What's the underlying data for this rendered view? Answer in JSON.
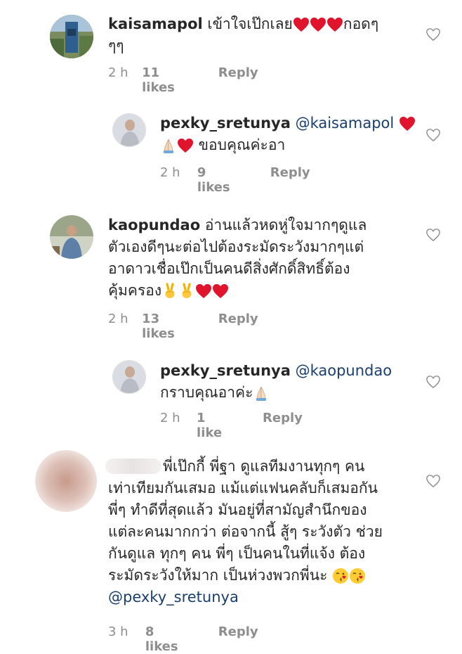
{
  "comments": [
    {
      "username": "kaisamapol",
      "text_before": " เข้าใจเป๊กเลย",
      "text_after": "กอดๆ",
      "line2": "ๆๆ",
      "time": "2 h",
      "likes": "11 likes",
      "reply": "Reply"
    },
    {
      "username": "pexky_sretunya",
      "mention": "@kaisamapol",
      "text": " ขอบคุณค่ะอา",
      "time": "2 h",
      "likes": "9 likes",
      "reply": "Reply"
    },
    {
      "username": "kaopundao",
      "line1": " อ่านแล้วหดหู่ใจมากๆดูแล",
      "line2": "ตัวเองดีๆนะต่อไปต้องระมัดระวังมากๆแต่",
      "line3": "อาดาวเชื่อเป๊กเป็นคนดีสิ่งศักดิ์สิทธิ์ต้อง",
      "line4": "คุ้มครอง",
      "time": "2 h",
      "likes": "13 likes",
      "reply": "Reply"
    },
    {
      "username": "pexky_sretunya",
      "mention": "@kaopundao",
      "text": "กราบคุณอาค่ะ",
      "time": "2 h",
      "likes": "1 like",
      "reply": "Reply"
    },
    {
      "line1": "พี่เป๊กกี้ พี่ฐา ดูแลทีมงานทุกๆ คน",
      "line2": "เท่าเทียมกันเสมอ แม้แต่แฟนคลับก็เสมอกัน",
      "line3": "พี่ๆ ทำดีที่สุดแล้ว มันอยู่ที่สามัญสำนึกของ",
      "line4": "แต่ละคนมากกว่า ต่อจากนี้ สู้ๆ ระวังตัว ช่วย",
      "line5": "กันดูแล ทุกๆ คน พี่ๆ เป็นคนในที่แจ้ง ต้อง",
      "line6": "ระมัดระวังให้มาก เป็นห่วงพวกพี่นะ",
      "mention": "@pexky_sretunya",
      "time": "3 h",
      "likes": "8 likes",
      "reply": "Reply"
    }
  ],
  "colors": {
    "heart": "#e0142c",
    "meta": "#8e8e8e",
    "mention": "#1a3e6e"
  }
}
